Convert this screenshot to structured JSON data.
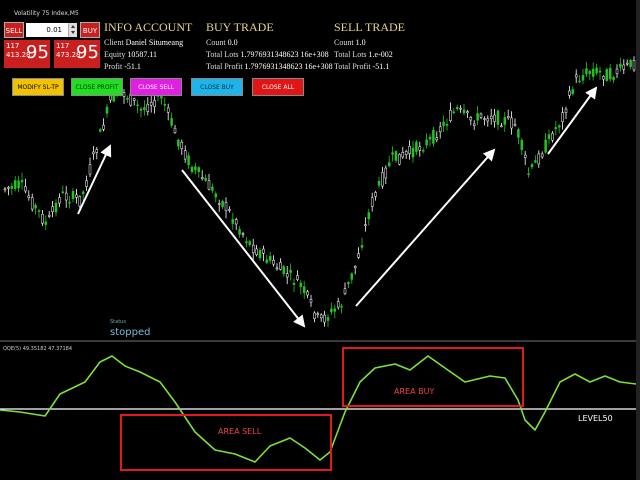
{
  "window": {
    "symbol_title": "Volatility 75 Index,M5"
  },
  "trade_widget": {
    "sell_label": "SELL",
    "buy_label": "BUY",
    "lot_value": "0.01",
    "bid": {
      "line1": "117",
      "line2": "413.28",
      "big": "95"
    },
    "ask": {
      "line1": "117",
      "line2": "473.28",
      "big": "95"
    }
  },
  "info_account": {
    "title": "INFO ACCOUNT",
    "client_label": "Client",
    "client": "Daniel Situmeang",
    "equity_label": "Equity",
    "equity": "10587.11",
    "profit_label": "Profit",
    "profit": "-51.1"
  },
  "buy_trade": {
    "title": "BUY TRADE",
    "count_label": "Count",
    "count": "0.0",
    "lots_label": "Total Lots",
    "lots": "1.7976931348623 16e+308",
    "profit_label": "Total Profit",
    "profit": "1.7976931348623 16e+308"
  },
  "sell_trade": {
    "title": "SELL TRADE",
    "count_label": "Count",
    "count": "1.0",
    "lots_label": "Total Lots",
    "lots": "1.e-002",
    "profit_label": "Total Profit",
    "profit": "-51.1"
  },
  "actions": [
    {
      "label": "MODIFY SL-TP",
      "bg": "#f2c200",
      "fg": "#000000"
    },
    {
      "label": "CLOSE PROFIT",
      "bg": "#22dd22",
      "fg": "#003300"
    },
    {
      "label": "CLOSE SELL",
      "bg": "#e020e0",
      "fg": "#ffffff"
    },
    {
      "label": "CLOSE BUY",
      "bg": "#1fb4e8",
      "fg": "#00304a"
    },
    {
      "label": "CLOSE ALL",
      "bg": "#e01515",
      "fg": "#ffffff"
    }
  ],
  "status": {
    "label": "Status",
    "value": "stopped"
  },
  "indicator": {
    "title": "QQE(5) 49.35182 47.37184",
    "area_buy_label": "AREA BUY",
    "area_sell_label": "AREA SELL",
    "level_label": "LEVEL50"
  },
  "colors": {
    "bull_candle": "#22c522",
    "bear_candle": "#ffffff",
    "qqe_line": "#7ddf3e",
    "level_line": "#ffffff",
    "area_box": "#e01b1b",
    "arrow": "#ffffff"
  }
}
